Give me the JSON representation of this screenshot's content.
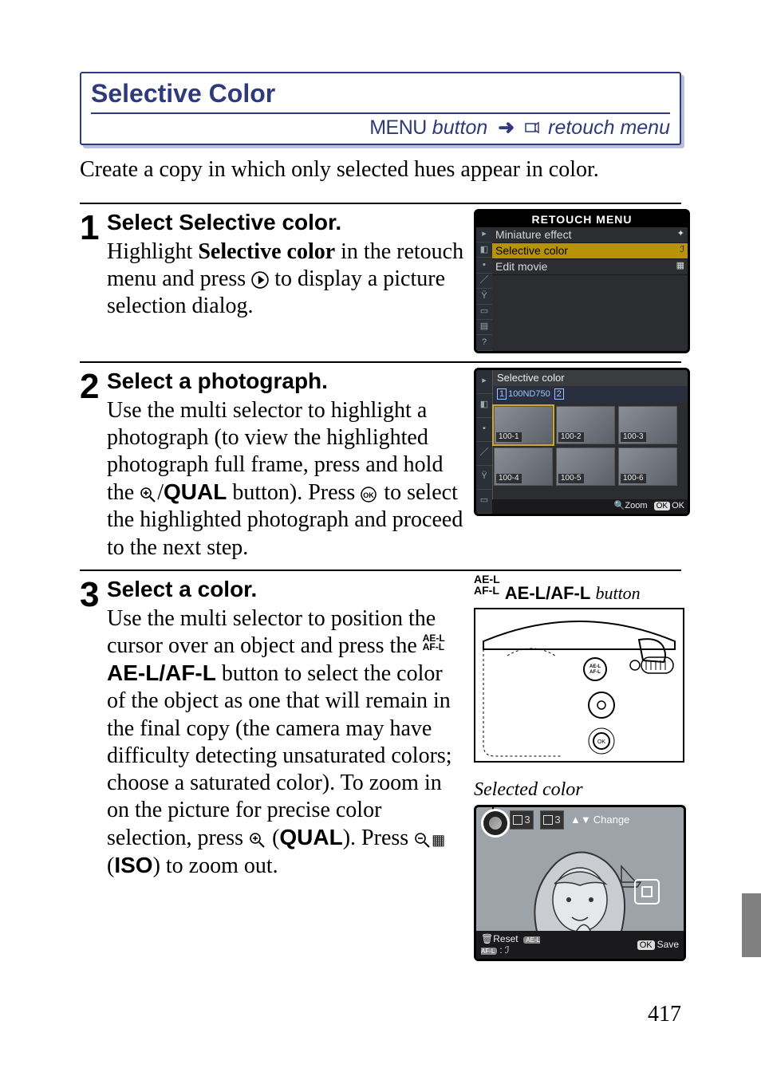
{
  "header": {
    "title": "Selective Color",
    "menu_label": "MENU",
    "button_word": "button",
    "retouch_menu": "retouch menu"
  },
  "intro": "Create a copy in which only selected hues appear in color.",
  "steps": {
    "s1": {
      "num": "1",
      "title_pre": "Select ",
      "title_bold": "Selective color",
      "title_post": ".",
      "body_pre": "Highlight ",
      "body_bold": "Selective color",
      "body_post1": " in the retouch menu and press ",
      "body_post2": " to display a picture selection dialog."
    },
    "s2": {
      "num": "2",
      "title": "Select a photograph.",
      "body_pre": "Use the multi selector to highlight a photograph (to view the highlighted photograph full frame, press and hold the ",
      "qual_btn": "QUAL",
      "body_mid": " button). Press ",
      "body_post": " to select the highlighted photograph and proceed to the next step."
    },
    "s3": {
      "num": "3",
      "title": "Select a color.",
      "body_1": "Use the multi selector to position the cursor over an object and press the ",
      "ael_btn": "AE-L/AF-L",
      "body_2": " button to select the color of the object as one that will remain in the final copy (the camera may have difficulty detecting unsaturated colors; choose a saturated color). To zoom in on the picture for precise color selection, press ",
      "qual": "QUAL",
      "body_3": "). Press ",
      "iso": "ISO",
      "body_4": ") to zoom out."
    }
  },
  "lcd1": {
    "title": "RETOUCH MENU",
    "items": [
      {
        "label": "Miniature effect"
      },
      {
        "label": "Selective color"
      },
      {
        "label": "Edit movie"
      }
    ]
  },
  "lcd2": {
    "title": "Selective color",
    "crumb": "100ND750",
    "thumbs": [
      "100-1",
      "100-2",
      "100-3",
      "100-4",
      "100-5",
      "100-6"
    ],
    "zoom": "Zoom",
    "ok": "OK"
  },
  "illus_caption1_bold": "AE-L/AF-L",
  "illus_caption1_word": "button",
  "illus_caption2": "Selected color",
  "illus2_bar": {
    "chip_num": "3",
    "change": "Change",
    "reset": "Reset",
    "save": "Save",
    "ok": "OK"
  },
  "page_number": "417"
}
